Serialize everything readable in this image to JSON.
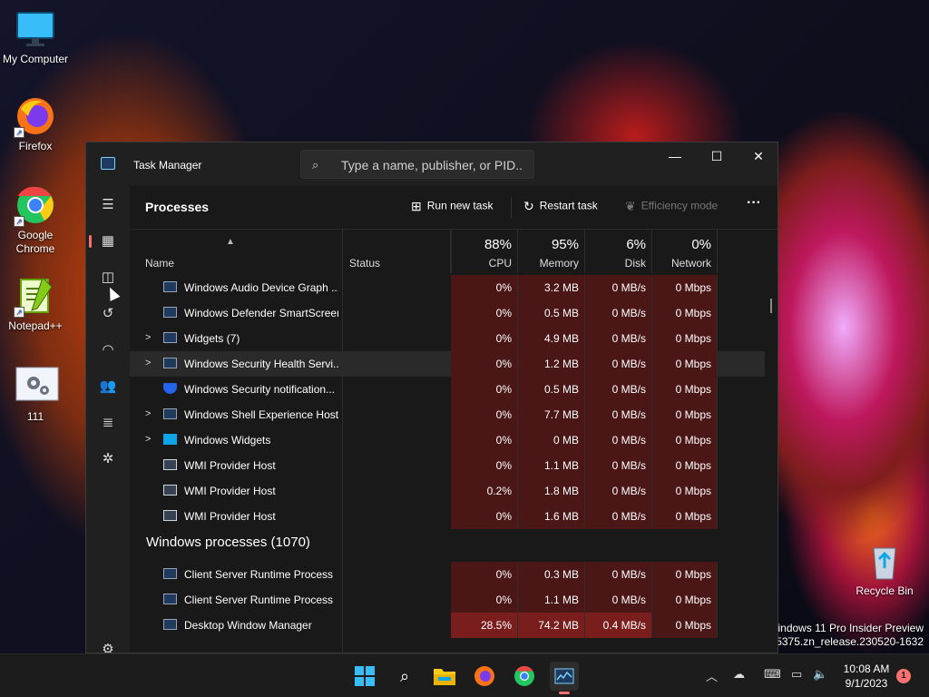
{
  "desktop": {
    "icons": [
      {
        "label": "My Computer",
        "icon": "monitor-icon"
      },
      {
        "label": "Firefox",
        "icon": "firefox-icon"
      },
      {
        "label": "Google Chrome",
        "icon": "chrome-icon"
      },
      {
        "label": "Notepad++",
        "icon": "notepadpp-icon"
      },
      {
        "label": "111",
        "icon": "settings-file-icon"
      },
      {
        "label": "Recycle Bin",
        "icon": "recycle-bin-icon"
      }
    ],
    "watermark": {
      "line1": "Windows 11 Pro Insider Preview",
      "line2": "d 25375.zn_release.230520-1632"
    }
  },
  "window": {
    "title": "Task Manager",
    "search_placeholder": "Type a name, publisher, or PID..."
  },
  "toolbar": {
    "page_title": "Processes",
    "run_new_task": "Run new task",
    "restart_task": "Restart task",
    "efficiency_mode": "Efficiency mode"
  },
  "columns": {
    "name": "Name",
    "status": "Status",
    "cpu": {
      "pct": "88%",
      "label": "CPU"
    },
    "memory": {
      "pct": "95%",
      "label": "Memory"
    },
    "disk": {
      "pct": "6%",
      "label": "Disk"
    },
    "network": {
      "pct": "0%",
      "label": "Network"
    }
  },
  "rows": [
    {
      "name": "Windows Audio Device Graph ...",
      "expand": "",
      "icon": "app",
      "cpu": "0%",
      "mem": "3.2 MB",
      "disk": "0 MB/s",
      "net": "0 Mbps"
    },
    {
      "name": "Windows Defender SmartScreen",
      "expand": "",
      "icon": "app",
      "cpu": "0%",
      "mem": "0.5 MB",
      "disk": "0 MB/s",
      "net": "0 Mbps"
    },
    {
      "name": "Widgets (7)",
      "expand": ">",
      "icon": "app",
      "cpu": "0%",
      "mem": "4.9 MB",
      "disk": "0 MB/s",
      "net": "0 Mbps"
    },
    {
      "name": "Windows Security Health Servi...",
      "expand": ">",
      "icon": "app",
      "cpu": "0%",
      "mem": "1.2 MB",
      "disk": "0 MB/s",
      "net": "0 Mbps"
    },
    {
      "name": "Windows Security notification...",
      "expand": "",
      "icon": "shield",
      "cpu": "0%",
      "mem": "0.5 MB",
      "disk": "0 MB/s",
      "net": "0 Mbps"
    },
    {
      "name": "Windows Shell Experience Host",
      "expand": ">",
      "icon": "app",
      "cpu": "0%",
      "mem": "7.7 MB",
      "disk": "0 MB/s",
      "net": "0 Mbps"
    },
    {
      "name": "Windows Widgets",
      "expand": ">",
      "icon": "widg",
      "cpu": "0%",
      "mem": "0 MB",
      "disk": "0 MB/s",
      "net": "0 Mbps"
    },
    {
      "name": "WMI Provider Host",
      "expand": "",
      "icon": "wmi",
      "cpu": "0%",
      "mem": "1.1 MB",
      "disk": "0 MB/s",
      "net": "0 Mbps"
    },
    {
      "name": "WMI Provider Host",
      "expand": "",
      "icon": "wmi",
      "cpu": "0.2%",
      "mem": "1.8 MB",
      "disk": "0 MB/s",
      "net": "0 Mbps"
    },
    {
      "name": "WMI Provider Host",
      "expand": "",
      "icon": "wmi",
      "cpu": "0%",
      "mem": "1.6 MB",
      "disk": "0 MB/s",
      "net": "0 Mbps"
    }
  ],
  "group": {
    "name": "Windows processes (1070)"
  },
  "group_rows": [
    {
      "name": "Client Server Runtime Process",
      "icon": "app",
      "cpu": "0%",
      "mem": "0.3 MB",
      "disk": "0 MB/s",
      "net": "0 Mbps"
    },
    {
      "name": "Client Server Runtime Process",
      "icon": "app",
      "cpu": "0%",
      "mem": "1.1 MB",
      "disk": "0 MB/s",
      "net": "0 Mbps"
    },
    {
      "name": "Desktop Window Manager",
      "icon": "app",
      "cpu": "28.5%",
      "mem": "74.2 MB",
      "disk": "0.4 MB/s",
      "net": "0 Mbps"
    }
  ],
  "taskbar": {
    "time": "10:08 AM",
    "date": "9/1/2023",
    "notifications": "1"
  }
}
